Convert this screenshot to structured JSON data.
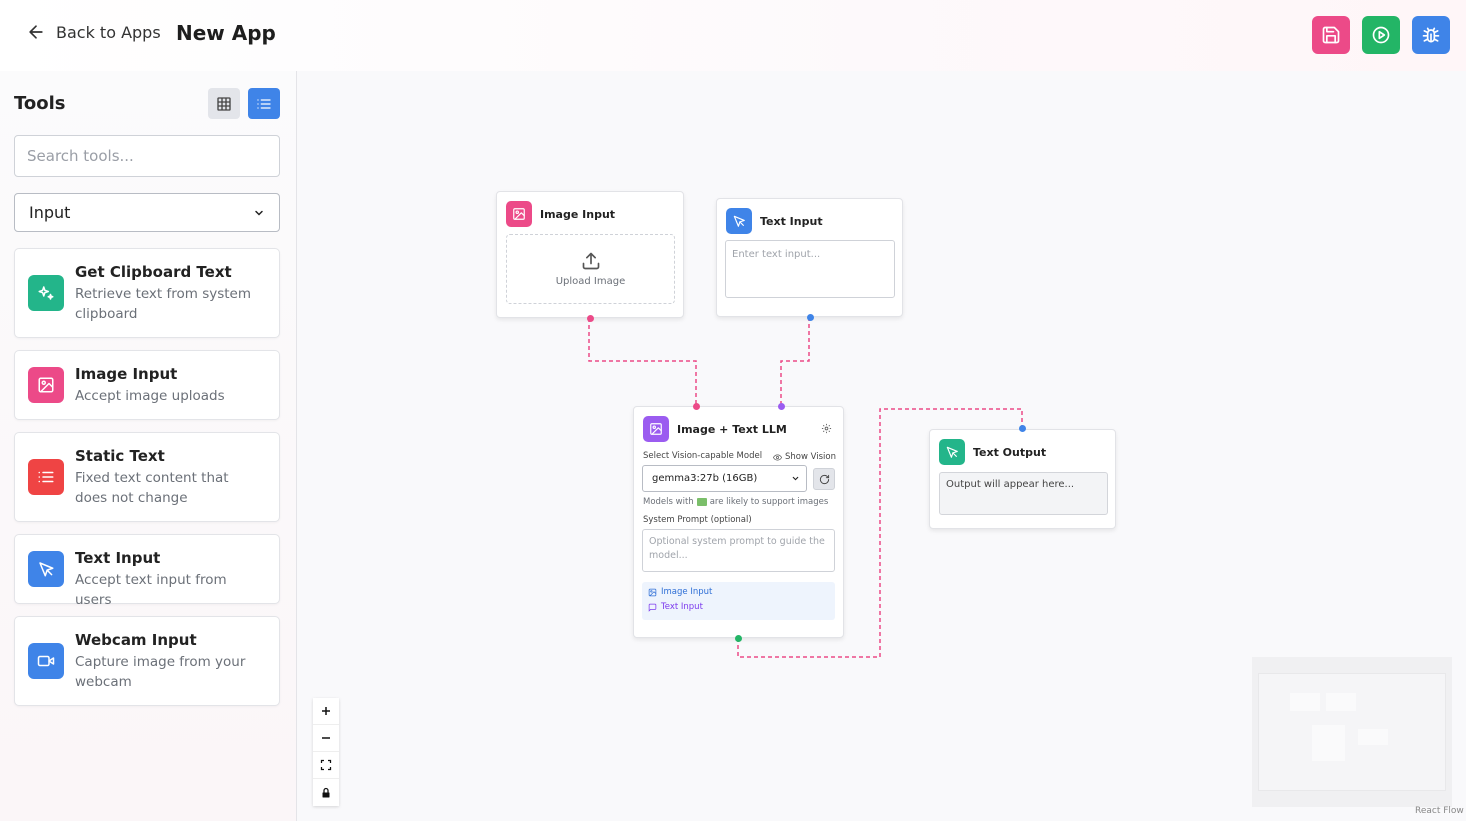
{
  "header": {
    "back_label": "Back to Apps",
    "app_title": "New App",
    "buttons": [
      {
        "name": "save",
        "icon": "save-icon",
        "color": "#ec4a88"
      },
      {
        "name": "run",
        "icon": "play-icon",
        "color": "#23b566"
      },
      {
        "name": "debug",
        "icon": "bug-icon",
        "color": "#3f84e8"
      }
    ]
  },
  "sidebar": {
    "title": "Tools",
    "search_placeholder": "Search tools...",
    "category_selected": "Input",
    "tools": [
      {
        "name": "Get Clipboard Text",
        "desc": "Retrieve text from system clipboard",
        "icon": "sparkles-icon",
        "color": "#23b58a"
      },
      {
        "name": "Image Input",
        "desc": "Accept image uploads",
        "icon": "image-icon",
        "color": "#ec4a88"
      },
      {
        "name": "Static Text",
        "desc": "Fixed text content that does not change",
        "icon": "list-icon",
        "color": "#ef4444"
      },
      {
        "name": "Text Input",
        "desc": "Accept text input from users",
        "icon": "cursor-icon",
        "color": "#3f84e8"
      },
      {
        "name": "Webcam Input",
        "desc": "Capture image from your webcam",
        "icon": "video-icon",
        "color": "#3f84e8"
      }
    ]
  },
  "canvas": {
    "image_input_node": {
      "title": "Image Input",
      "upload_label": "Upload Image"
    },
    "text_input_node": {
      "title": "Text Input",
      "placeholder": "Enter text input..."
    },
    "llm_node": {
      "title": "Image + Text LLM",
      "model_label": "Select Vision-capable Model",
      "show_vision": "Show Vision",
      "model_selected": "gemma3:27b (16GB)",
      "hint_prefix": "Models with",
      "hint_suffix": "are likely to support images",
      "system_label": "System Prompt (optional)",
      "system_placeholder": "Optional system prompt to guide the model...",
      "inputs": [
        "Image Input",
        "Text Input"
      ]
    },
    "text_output_node": {
      "title": "Text Output",
      "placeholder": "Output will appear here..."
    },
    "attribution": "React Flow"
  }
}
